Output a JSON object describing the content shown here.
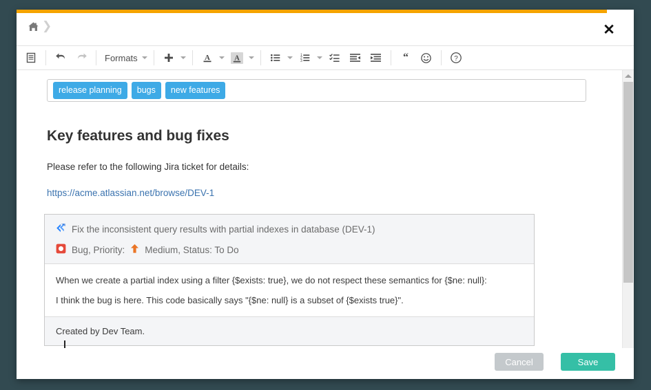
{
  "window": {
    "accent_orange": "#f5a300",
    "close_label": "✕"
  },
  "breadcrumb": {
    "home_icon": "home-icon",
    "separator": "❯"
  },
  "toolbar": {
    "items": [
      {
        "name": "source-code-button",
        "icon": "document-icon"
      },
      {
        "name": "undo-button",
        "icon": "undo-arrow-icon"
      },
      {
        "name": "redo-button",
        "icon": "redo-arrow-icon"
      },
      {
        "name": "formats-button",
        "label": "Formats",
        "icon": "chevron-down-icon"
      },
      {
        "name": "insert-button",
        "icon": "plus-icon"
      },
      {
        "name": "text-color-button",
        "icon": "text-color-a-icon"
      },
      {
        "name": "highlight-color-button",
        "icon": "highlight-a-icon"
      },
      {
        "name": "bullet-list-button",
        "icon": "bullet-list-icon"
      },
      {
        "name": "numbered-list-button",
        "icon": "numbered-list-icon"
      },
      {
        "name": "task-list-button",
        "icon": "checklist-icon"
      },
      {
        "name": "outdent-button",
        "icon": "outdent-icon"
      },
      {
        "name": "indent-button",
        "icon": "indent-icon"
      },
      {
        "name": "blockquote-button",
        "icon": "quote-icon"
      },
      {
        "name": "emoji-button",
        "icon": "smiley-icon"
      },
      {
        "name": "help-button",
        "icon": "question-mark-icon"
      }
    ],
    "formats_label": "Formats"
  },
  "tags": {
    "items": [
      "release planning",
      "bugs",
      "new features"
    ],
    "color": "#3eaae6"
  },
  "document": {
    "title": "Key features and bug fixes",
    "paragraph": "Please refer to the following Jira ticket for details:",
    "link": "https://acme.atlassian.net/browse/DEV-1"
  },
  "jira_card": {
    "summary": "Fix the inconsistent query results with partial indexes in database (DEV-1)",
    "meta_type": "Bug, Priority:",
    "meta_priority": "Medium, Status: To Do",
    "body_paragraphs": [
      "When we create a partial index using a filter {$exists: true}, we do not respect these semantics for {$ne: null}:",
      "I think the bug is here. This code basically says \"{$ne: null} is a subset of {$exists true}\"."
    ],
    "footer": "Created by Dev Team.",
    "jira_icon": "jira-logo-icon",
    "bug_icon": "bug-type-icon",
    "priority_icon": "priority-medium-arrow-icon",
    "bug_color": "#e5493a",
    "priority_color": "#ea7526",
    "jira_color": "#2684ff"
  },
  "footer": {
    "cancel_label": "Cancel",
    "save_label": "Save",
    "cancel_color": "#c4c9cc",
    "save_color": "#35bfa6"
  }
}
